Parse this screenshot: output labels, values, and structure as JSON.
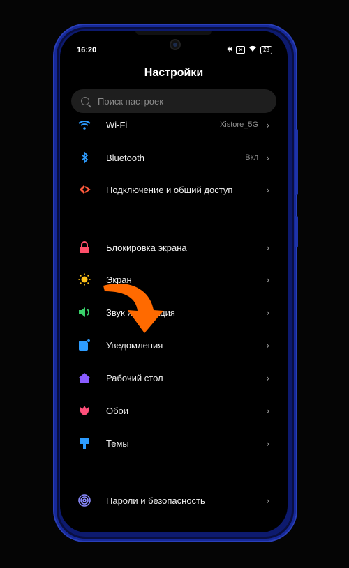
{
  "status": {
    "time": "16:20",
    "battery": "23"
  },
  "header": {
    "title": "Настройки"
  },
  "search": {
    "placeholder": "Поиск настроек"
  },
  "items": [
    {
      "label": "Wi-Fi",
      "value": "Xistore_5G",
      "icon": "wifi-icon",
      "color": "#2d9cff"
    },
    {
      "label": "Bluetooth",
      "value": "Вкл",
      "icon": "bluetooth-icon",
      "color": "#2d9cff"
    },
    {
      "label": "Подключение и общий доступ",
      "value": "",
      "icon": "share-icon",
      "color": "#ff5a3c"
    },
    {
      "label": "Блокировка экрана",
      "value": "",
      "icon": "lock-icon",
      "color": "#ff4f6a"
    },
    {
      "label": "Экран",
      "value": "",
      "icon": "sun-icon",
      "color": "#ffc21a"
    },
    {
      "label": "Звук и вибрация",
      "value": "",
      "icon": "speaker-icon",
      "color": "#39d06a"
    },
    {
      "label": "Уведомления",
      "value": "",
      "icon": "notification-icon",
      "color": "#2d9cff"
    },
    {
      "label": "Рабочий стол",
      "value": "",
      "icon": "home-icon",
      "color": "#8a5cff"
    },
    {
      "label": "Обои",
      "value": "",
      "icon": "wallpaper-icon",
      "color": "#ff4f7a"
    },
    {
      "label": "Темы",
      "value": "",
      "icon": "themes-icon",
      "color": "#2d9cff"
    },
    {
      "label": "Пароли и безопасность",
      "value": "",
      "icon": "fingerprint-icon",
      "color": "#8a8aff"
    }
  ],
  "colors": {
    "annotation_arrow": "#ff6a00",
    "frame": "#1f33a8"
  }
}
